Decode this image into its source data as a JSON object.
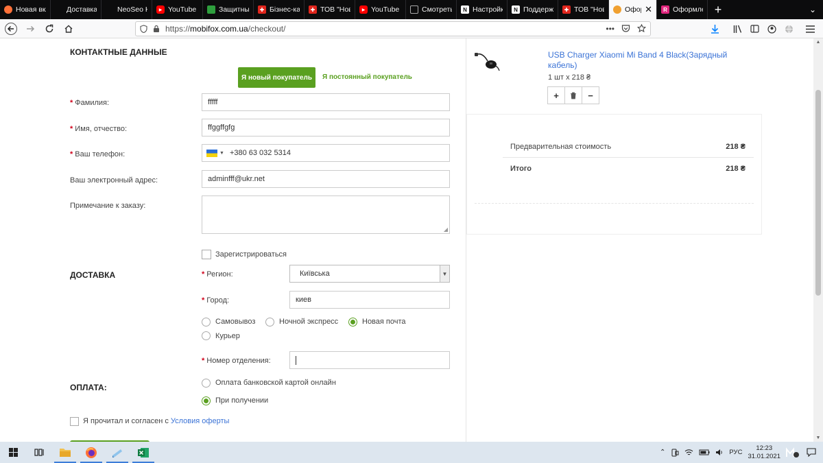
{
  "browser": {
    "tabs": [
      {
        "title": "Новая вкладка",
        "icon": "firefox-icon",
        "color": "#ff7139"
      },
      {
        "title": "Доставка",
        "icon": "blank-page-icon",
        "color": "#0c0c0d"
      },
      {
        "title": "NeoSeo Новая",
        "icon": "blank-page-icon",
        "color": "#0c0c0d"
      },
      {
        "title": "YouTube",
        "icon": "youtube-icon",
        "color": "#ff0000"
      },
      {
        "title": "Защитные",
        "icon": "shield-grid-icon",
        "color": "#2e9e3d"
      },
      {
        "title": "Бізнес-ка",
        "icon": "red-cross-icon",
        "color": "#e0261d"
      },
      {
        "title": "ТОВ \"Нова",
        "icon": "red-cross-icon",
        "color": "#e0261d"
      },
      {
        "title": "YouTube",
        "icon": "youtube-icon",
        "color": "#ff0000"
      },
      {
        "title": "Смотреть",
        "icon": "hd-icon",
        "color": "#555555"
      },
      {
        "title": "Настройки",
        "icon": "ns-icon",
        "color": "#ffffff"
      },
      {
        "title": "Поддержка",
        "icon": "ns-icon",
        "color": "#ffffff"
      },
      {
        "title": "ТОВ \"Нова",
        "icon": "red-cross-icon",
        "color": "#e0261d"
      },
      {
        "title": "Оформ",
        "icon": "mobifox-icon",
        "color": "#f0a030",
        "active": true
      },
      {
        "title": "Оформле",
        "icon": "r-icon",
        "color": "#e0267d"
      }
    ],
    "new_tab": "+",
    "url_prefix": "https://",
    "url_host": "mobifox.com.ua",
    "url_path": "/checkout/"
  },
  "contact": {
    "heading": "КОНТАКТНЫЕ ДАННЫЕ",
    "new_customer_btn": "Я новый покупатель",
    "returning_customer_link": "Я постоянный покупатель",
    "surname_label": "Фамилия:",
    "surname_value": "fffff",
    "name_label": "Имя, отчество:",
    "name_value": "ffggffgfg",
    "phone_label": "Ваш телефон:",
    "phone_value": "+380 63 032 5314",
    "email_label": "Ваш электронный адрес:",
    "email_value": "adminfff@ukr.net",
    "note_label": "Примечание к заказу:",
    "register_label": "Зарегистрироваться",
    "required_mark": "*"
  },
  "delivery": {
    "heading": "ДОСТАВКА",
    "region_label": "Регион:",
    "region_value": "Київська",
    "city_label": "Город:",
    "city_value": "киев",
    "options": [
      "Самовывоз",
      "Ночной экспресс",
      "Новая почта",
      "Курьер"
    ],
    "selected_option": "Новая почта",
    "branch_label": "Номер отделения:",
    "branch_value": ""
  },
  "payment": {
    "heading": "ОПЛАТА:",
    "options": [
      "Оплата банковской картой онлайн",
      "При получении"
    ],
    "selected_option": "При получении",
    "agree_text": "Я прочитал и согласен с ",
    "agree_link": "Условия оферты"
  },
  "cart": {
    "product_name": "USB Charger Xiaomi Mi Band 4 Black(Зарядный кабель)",
    "product_qty": "1 шт х 218 ₴",
    "plus": "+",
    "minus": "−",
    "subtotal_label": "Предварительная стоимость",
    "subtotal_value": "218 ₴",
    "total_label": "Итого",
    "total_value": "218 ₴"
  },
  "taskbar": {
    "lang": "РУС",
    "time": "12:23",
    "date": "31.01.2021"
  },
  "colors": {
    "accent_green": "#5aa020",
    "link_blue": "#3b73d6",
    "required_red": "#d0021b"
  }
}
